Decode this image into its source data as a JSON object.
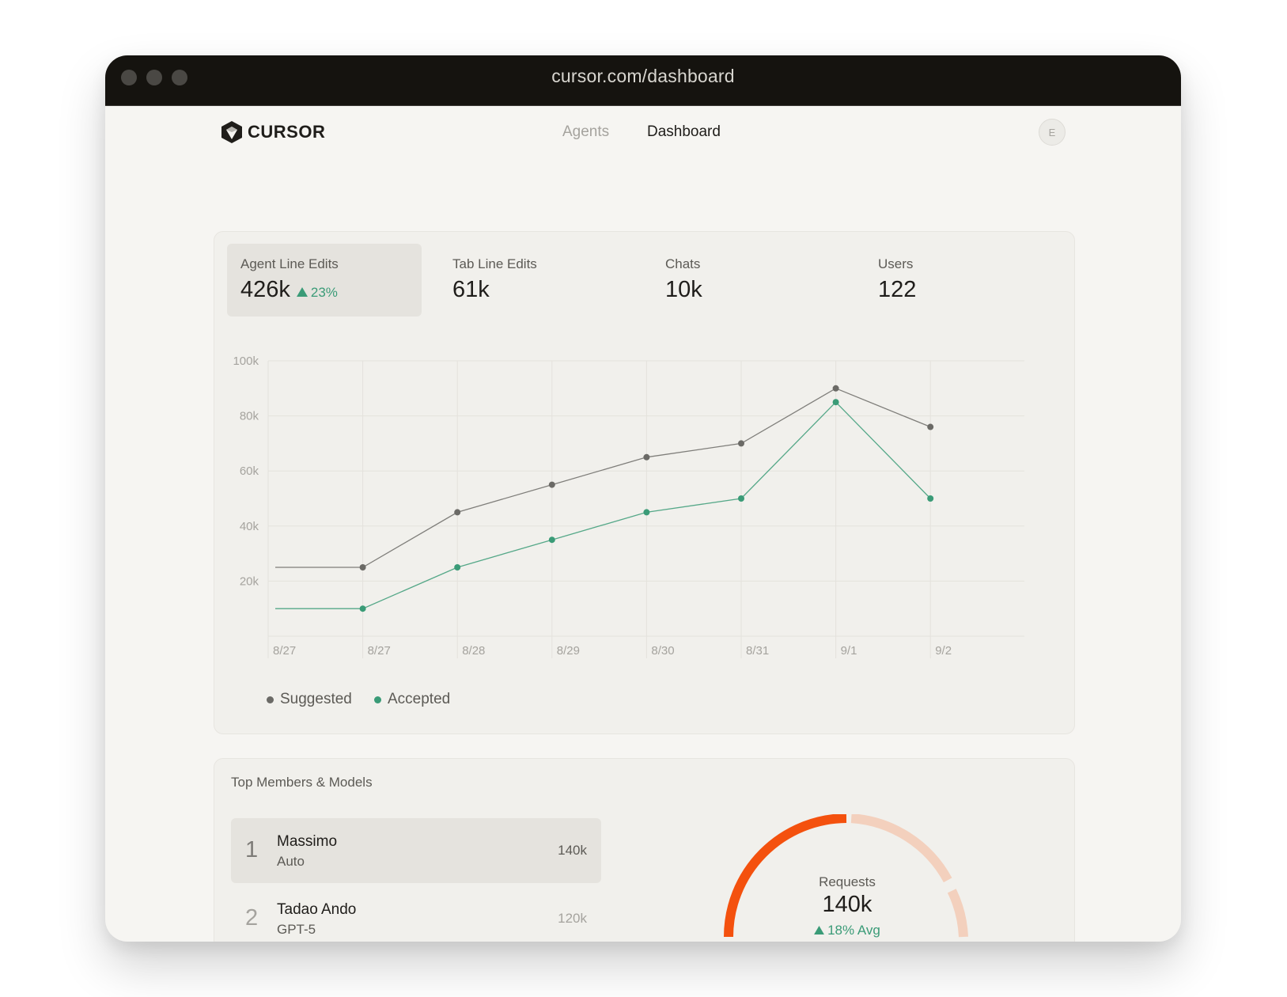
{
  "browser": {
    "url": "cursor.com/dashboard"
  },
  "nav": {
    "brand": "CURSOR",
    "links": [
      "Agents",
      "Dashboard"
    ],
    "active_link": "Dashboard",
    "avatar_initial": "E"
  },
  "stats": [
    {
      "label": "Agent Line Edits",
      "value": "426k",
      "delta": "23%",
      "active": true
    },
    {
      "label": "Tab Line Edits",
      "value": "61k"
    },
    {
      "label": "Chats",
      "value": "10k"
    },
    {
      "label": "Users",
      "value": "122"
    }
  ],
  "chart_data": {
    "type": "line",
    "x": [
      "8/27",
      "8/27",
      "8/28",
      "8/29",
      "8/30",
      "8/31",
      "9/1",
      "9/2"
    ],
    "series": [
      {
        "name": "Suggested",
        "color": "#6b6a66",
        "values": [
          25000,
          25000,
          45000,
          55000,
          65000,
          70000,
          90000,
          76000
        ]
      },
      {
        "name": "Accepted",
        "color": "#3a9b77",
        "values": [
          10000,
          10000,
          25000,
          35000,
          45000,
          50000,
          85000,
          50000
        ]
      }
    ],
    "y_ticks": [
      "100k",
      "80k",
      "60k",
      "40k",
      "20k"
    ],
    "ylim": [
      0,
      100000
    ],
    "grid": true,
    "legend": "bottom-left"
  },
  "members": {
    "title": "Top Members & Models",
    "rows": [
      {
        "rank": "1",
        "name": "Massimo",
        "model": "Auto",
        "value": "140k",
        "active": true
      },
      {
        "rank": "2",
        "name": "Tadao Ando",
        "model": "GPT-5",
        "value": "120k"
      }
    ]
  },
  "requests": {
    "label": "Requests",
    "value": "140k",
    "delta": "18% Avg",
    "colors": {
      "primary": "#f4510e",
      "secondary": "#f3d0bd"
    }
  },
  "colors": {
    "accent_green": "#3a9b77",
    "titlebar": "#15130f"
  }
}
